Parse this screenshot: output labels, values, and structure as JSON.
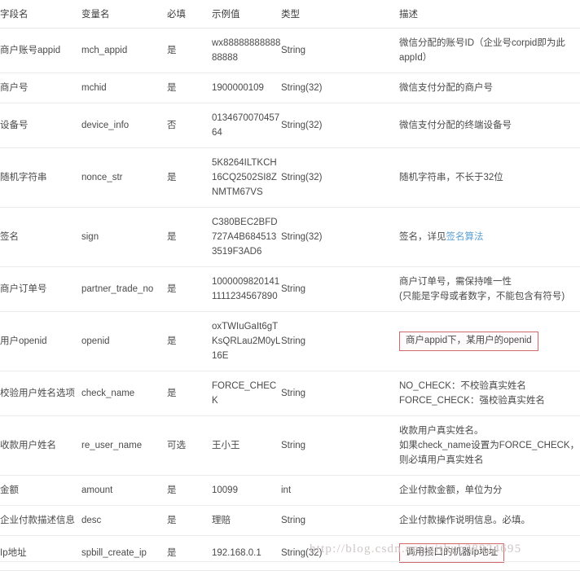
{
  "table": {
    "headers": [
      "字段名",
      "变量名",
      "必填",
      "示例值",
      "类型",
      "描述"
    ],
    "rows": [
      {
        "field": "商户账号appid",
        "variable": "mch_appid",
        "required": "是",
        "example": "wx8888888888888888",
        "type": "String",
        "desc": "微信分配的账号ID（企业号corpid即为此appId）"
      },
      {
        "field": "商户号",
        "variable": "mchid",
        "required": "是",
        "example": "1900000109",
        "type": "String(32)",
        "desc": "微信支付分配的商户号"
      },
      {
        "field": "设备号",
        "variable": "device_info",
        "required": "否",
        "example": "013467007045764",
        "type": "String(32)",
        "desc": "微信支付分配的终端设备号"
      },
      {
        "field": "随机字符串",
        "variable": "nonce_str",
        "required": "是",
        "example": "5K8264ILTKCH16CQ2502SI8ZNMTM67VS",
        "type": "String(32)",
        "desc": "随机字符串，不长于32位"
      },
      {
        "field": "签名",
        "variable": "sign",
        "required": "是",
        "example": "C380BEC2BFD727A4B6845133519F3AD6",
        "type": "String(32)",
        "desc_prefix": "签名，详见",
        "desc_link": "签名算法"
      },
      {
        "field": "商户订单号",
        "variable": "partner_trade_no",
        "required": "是",
        "example": "10000098201411111234567890",
        "type": "String",
        "desc": "商户订单号，需保持唯一性\n(只能是字母或者数字，不能包含有符号)"
      },
      {
        "field": "用户openid",
        "variable": "openid",
        "required": "是",
        "example": "oxTWIuGaIt6gTKsQRLau2M0yL16E",
        "type": "String",
        "desc_annotated": "商户appid下，某用户的openid"
      },
      {
        "field": "校验用户姓名选项",
        "variable": "check_name",
        "required": "是",
        "example": "FORCE_CHECK",
        "type": "String",
        "desc": "NO_CHECK：不校验真实姓名\nFORCE_CHECK：强校验真实姓名"
      },
      {
        "field": "收款用户姓名",
        "variable": "re_user_name",
        "required": "可选",
        "example": "王小王",
        "type": "String",
        "desc": "收款用户真实姓名。\n如果check_name设置为FORCE_CHECK，则必填用户真实姓名"
      },
      {
        "field": "金额",
        "variable": "amount",
        "required": "是",
        "example": "10099",
        "type": "int",
        "desc": "企业付款金额，单位为分"
      },
      {
        "field": "企业付款描述信息",
        "variable": "desc",
        "required": "是",
        "example": "理赔",
        "type": "String",
        "desc": "企业付款操作说明信息。必填。"
      },
      {
        "field": "Ip地址",
        "variable": "spbill_create_ip",
        "required": "是",
        "example": "192.168.0.1",
        "type": "String(32)",
        "desc_annotated": "调用接口的机器Ip地址"
      }
    ]
  },
  "watermark": {
    "text": "http://blog.csdn.net/github38924695"
  },
  "colors": {
    "annotation_border": "#d06a6a",
    "link": "#5a9fd4",
    "row_divider": "#ebebeb",
    "text": "#4a4a4a"
  }
}
